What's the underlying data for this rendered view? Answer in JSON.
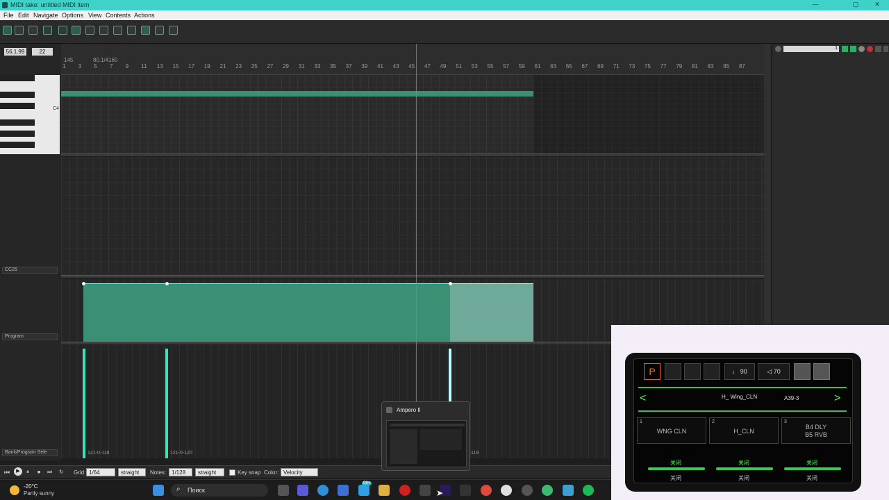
{
  "window": {
    "title": "MIDI take: untitled MIDI item",
    "min": "—",
    "max": "▢",
    "close": "✕"
  },
  "menu": [
    "File",
    "Edit",
    "Navigate",
    "Options",
    "View",
    "Contents",
    "Actions"
  ],
  "position": {
    "time": "56.1.99",
    "value": "22"
  },
  "ruler": {
    "top_marks": [
      "145",
      "80.1/4",
      "160"
    ],
    "bars": [
      "1",
      "3",
      "5",
      "7",
      "9",
      "11",
      "13",
      "15",
      "17",
      "19",
      "21",
      "23",
      "25",
      "27",
      "29",
      "31",
      "33",
      "35",
      "37",
      "39",
      "41",
      "43",
      "45",
      "47",
      "49",
      "51",
      "53",
      "55",
      "57",
      "59",
      "61",
      "63",
      "65",
      "67",
      "69",
      "71",
      "73",
      "75",
      "77",
      "79",
      "81",
      "83",
      "85",
      "87"
    ]
  },
  "piano": {
    "c_label": "C4"
  },
  "lanes": {
    "cc": "CC25",
    "program": "Program",
    "bank": "Bank/Program Sele"
  },
  "bank_events": [
    "121-0-118",
    "121-0-120",
    "119"
  ],
  "toolbar_right": {
    "value": "1"
  },
  "bottom": {
    "grid_label": "Grid:",
    "grid_value": "1/64",
    "grid_mode": "straight",
    "notes_label": "Notes:",
    "notes_value": "1/128",
    "notes_mode": "straight",
    "keysnap": "Key snap",
    "color_label": "Color:",
    "color_value": "Velocity"
  },
  "taskbar": {
    "weather_temp": "-20°C",
    "weather_desc": "Partly sunny",
    "search": "Поиск",
    "badge": "99+"
  },
  "thumb": {
    "title": "Ampero II"
  },
  "device": {
    "tempo": "90",
    "volume": "70",
    "preset_name": "H_ Wing_CLN",
    "preset_id": "A39-3",
    "slots": [
      {
        "n": "1",
        "name": "WNG CLN"
      },
      {
        "n": "2",
        "name": "H_CLN"
      },
      {
        "n": "3",
        "name": "B4 DLY\nB5 RVB"
      }
    ],
    "fs_top": [
      "关闭",
      "关闭",
      "关闭"
    ],
    "fs_bottom": [
      "关闭",
      "关闭",
      "关闭"
    ]
  },
  "colors": {
    "accent": "#3fd2c8",
    "note": "#3f8f73",
    "lane_fill": "#3a8f74"
  }
}
